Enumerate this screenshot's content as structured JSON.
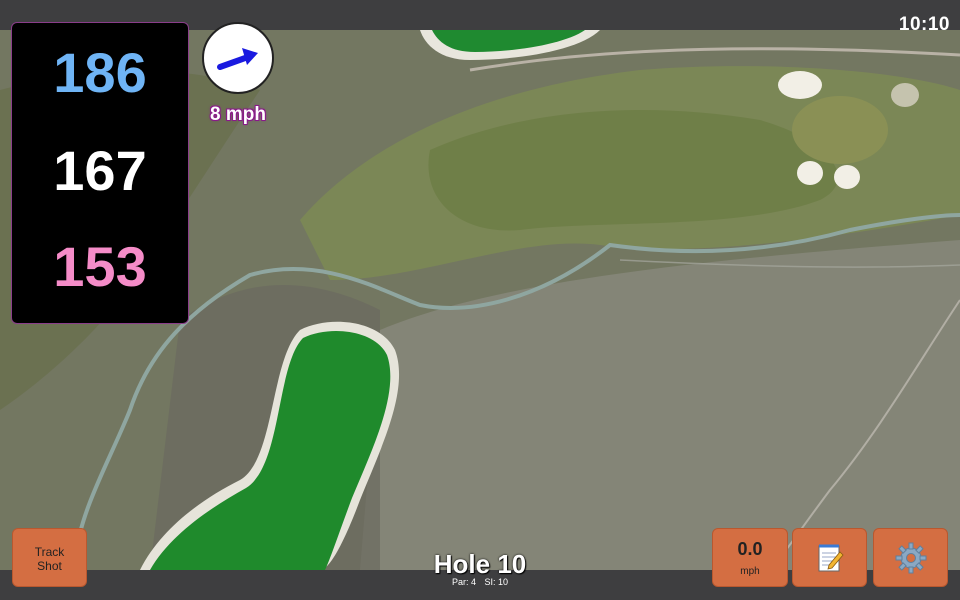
{
  "status": {
    "time": "10:10"
  },
  "distances": {
    "back": {
      "value": "186",
      "color": "#6fb4f5"
    },
    "middle": {
      "value": "167",
      "color": "#ffffff"
    },
    "front": {
      "value": "153",
      "color": "#f58cc8"
    }
  },
  "wind": {
    "speed_label": "8 mph",
    "arrow_color": "#1a1ae0",
    "icon": "wind-direction-arrow"
  },
  "buttons": {
    "track_shot": {
      "line1": "Track",
      "line2": "Shot"
    },
    "speed": {
      "value": "0.0",
      "unit": "mph"
    },
    "notes": {
      "icon": "notepad-icon"
    },
    "settings": {
      "icon": "gear-icon"
    }
  },
  "hole": {
    "title": "Hole 10",
    "par": "Par: 4",
    "si": "SI: 10"
  },
  "colors": {
    "button_bg": "#d46e42",
    "bar_bg": "#3e3e40",
    "panel_border": "#8a3d8a"
  }
}
